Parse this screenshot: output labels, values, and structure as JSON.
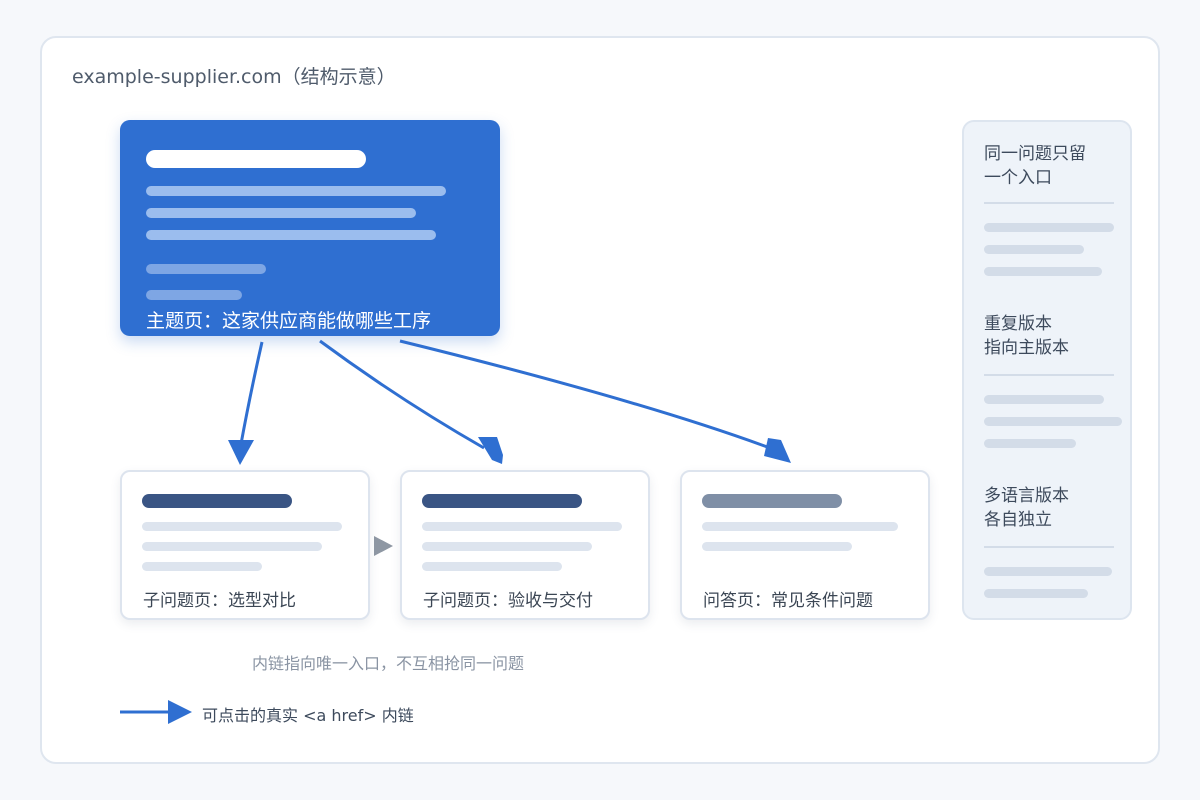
{
  "site": {
    "title": "example-supplier.com（结构示意）"
  },
  "main_page": {
    "label": "主题页：这家供应商能做哪些工序"
  },
  "sub_pages": [
    {
      "label": "子问题页：选型对比"
    },
    {
      "label": "子问题页：验收与交付"
    },
    {
      "label": "问答页：常见条件问题"
    }
  ],
  "side_panel": {
    "sections": [
      {
        "heading_line1": "同一问题只留",
        "heading_line2": "一个入口"
      },
      {
        "heading_line1": "重复版本",
        "heading_line2": "指向主版本"
      },
      {
        "heading_line1": "多语言版本",
        "heading_line2": "各自独立"
      }
    ]
  },
  "caption": "内链指向唯一入口，不互相抢同一问题",
  "legend": {
    "label": "可点击的真实 <a href> 内链",
    "icon": "arrow-right-icon"
  },
  "colors": {
    "accent": "#2f6fd1",
    "title_bar_dark": "#3a5584",
    "title_bar_muted": "#7f8fa6",
    "placeholder": "#dde4ee",
    "connector": "#8e97a3"
  }
}
